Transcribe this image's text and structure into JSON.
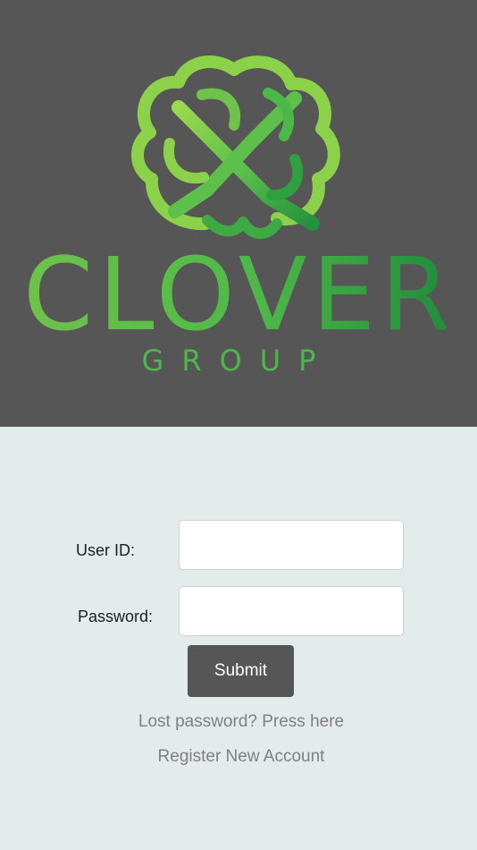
{
  "brand": {
    "name": "CLOVER",
    "subname": "GROUP",
    "logo_icon": "clover-knot-icon",
    "colors": {
      "header_bg": "#575657",
      "page_bg": "#e4ebeb",
      "green_light": "#8cd14a",
      "green_mid": "#4cb848",
      "green_dark": "#1f8a3c"
    }
  },
  "login": {
    "user_id_label": "User ID:",
    "user_id_value": "",
    "password_label": "Password:",
    "password_value": "",
    "submit_label": "Submit",
    "lost_password_link": "Lost password? Press here",
    "register_link": "Register New Account"
  }
}
